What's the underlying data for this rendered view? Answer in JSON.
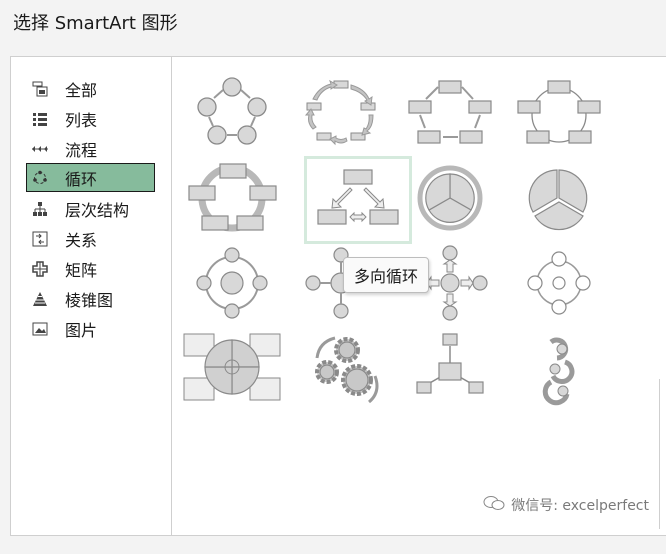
{
  "window": {
    "title": "选择 SmartArt 图形"
  },
  "sidebar": {
    "items": [
      {
        "label": "全部",
        "icon": "all-icon"
      },
      {
        "label": "列表",
        "icon": "list-icon"
      },
      {
        "label": "流程",
        "icon": "process-icon"
      },
      {
        "label": "循环",
        "icon": "cycle-icon",
        "selected": true
      },
      {
        "label": "层次结构",
        "icon": "hierarchy-icon"
      },
      {
        "label": "关系",
        "icon": "relationship-icon"
      },
      {
        "label": "矩阵",
        "icon": "matrix-icon"
      },
      {
        "label": "棱锥图",
        "icon": "pyramid-icon"
      },
      {
        "label": "图片",
        "icon": "picture-icon"
      }
    ]
  },
  "gallery": {
    "selected_tile": "multidirectional-cycle",
    "tooltip": "多向循环"
  },
  "watermark": {
    "text": "微信号: excelperfect"
  },
  "colors": {
    "selected_bg": "#86bb9c",
    "shape_fill": "#c8c8c8",
    "shape_stroke": "#8a8a8a",
    "highlight": "#d5eadd"
  }
}
